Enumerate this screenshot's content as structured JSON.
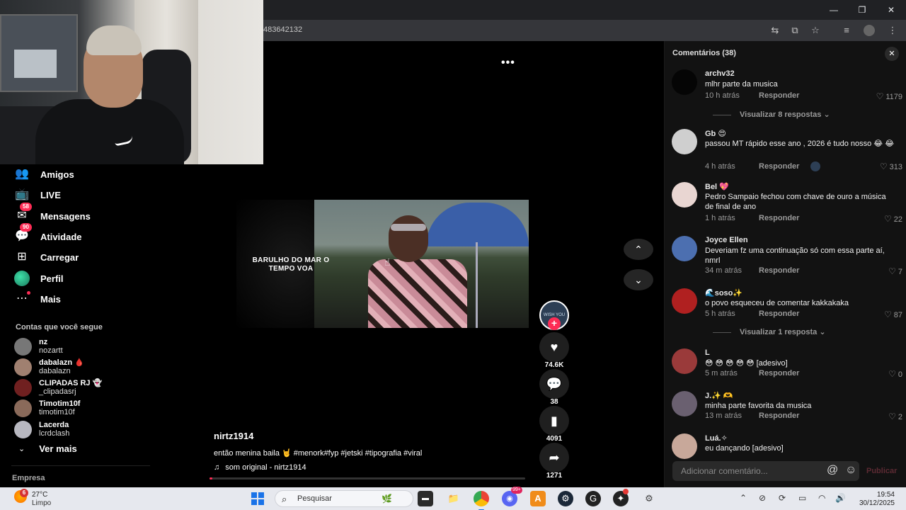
{
  "browser": {
    "url_fragment": "483642132",
    "window_controls": {
      "minimize": "—",
      "maximize": "❐",
      "close": "✕"
    },
    "toolbar_icons": [
      "translate-icon",
      "cast-icon",
      "bookmark-star-icon",
      "media-controls-icon",
      "profile-icon",
      "menu-icon"
    ]
  },
  "sidebar": {
    "nav": [
      {
        "label": "Amigos",
        "icon": "friends-icon",
        "badge": ""
      },
      {
        "label": "LIVE",
        "icon": "live-icon",
        "badge": ""
      },
      {
        "label": "Mensagens",
        "icon": "messages-icon",
        "badge": "58"
      },
      {
        "label": "Atividade",
        "icon": "activity-icon",
        "badge": "90"
      },
      {
        "label": "Carregar",
        "icon": "upload-icon",
        "badge": ""
      },
      {
        "label": "Perfil",
        "icon": "profile-avatar",
        "badge": ""
      },
      {
        "label": "Mais",
        "icon": "more-icon",
        "badge": ""
      }
    ],
    "following_title": "Contas que você segue",
    "following": [
      {
        "name": "nz",
        "user": "nozartt"
      },
      {
        "name": "dabalazn 🩸",
        "user": "dabalazn"
      },
      {
        "name": "CLIPADAS RJ 👻",
        "user": "_clipadasrj"
      },
      {
        "name": "Timotim10f",
        "user": "timotim10f"
      },
      {
        "name": "Lacerda",
        "user": "lcrdclash"
      }
    ],
    "see_more": "Ver mais",
    "footer": "Empresa"
  },
  "video": {
    "caption_overlay": "BARULHO DO MAR O TEMPO VOA",
    "more_button": "•••",
    "author": "nirtz1914",
    "description": "então menina baila 🤘 #menork#fyp #jetski #tipografia #viral",
    "music": "som original - nirtz1914",
    "progress": 0.01,
    "creator_avatar_text": "WISH YOU",
    "counts": {
      "likes": "74.6K",
      "comments": "38",
      "saves": "4091",
      "shares": "1271"
    }
  },
  "comments": {
    "title": "Comentários (38)",
    "reply_label": "Responder",
    "items": [
      {
        "user": "archv32",
        "text": "mlhr parte da musica",
        "time": "10 h atrás",
        "likes": "1179",
        "replies": "Visualizar 8 respostas",
        "avatar_color": "#050505"
      },
      {
        "user": "Gb 😍",
        "text": "passou MT rápido esse ano , 2026 é tudo nosso 😂 😂",
        "time": "4 h atrás",
        "likes": "313",
        "replies": "",
        "avatar_color": "#cfcfcf",
        "creator_liked": true
      },
      {
        "user": "Bel 💖",
        "text": "Pedro Sampaio fechou com chave de ouro a música de final de ano",
        "time": "1 h atrás",
        "likes": "22",
        "replies": "",
        "avatar_color": "#e9d6d2"
      },
      {
        "user": "Joyce Ellen",
        "text": "Deveriam fz uma continuação só com essa parte aí, nmrl",
        "time": "34 m atrás",
        "likes": "7",
        "replies": "",
        "avatar_color": "#4c6fb0"
      },
      {
        "user": "🌊soso✨",
        "text": "o povo esqueceu de comentar kakkakaka",
        "time": "5 h atrás",
        "likes": "87",
        "replies": "Visualizar 1 resposta",
        "avatar_color": "#b02020"
      },
      {
        "user": "L",
        "text": "😳 😳 😳 😳 😳 [adesivo]",
        "time": "5 m atrás",
        "likes": "0",
        "replies": "",
        "avatar_color": "#9a3a3a"
      },
      {
        "user": "J.✨ 🫶",
        "text": "minha parte favorita da musica",
        "time": "13 m atrás",
        "likes": "2",
        "replies": "",
        "avatar_color": "#6a6070"
      },
      {
        "user": "Luá.✧",
        "text": "eu dançando [adesivo]",
        "time": "",
        "likes": "",
        "replies": "",
        "avatar_color": "#c8a89a"
      }
    ],
    "input_placeholder": "Adicionar comentário...",
    "post_label": "Publicar"
  },
  "taskbar": {
    "weather_badge": "6",
    "temperature": "27°C",
    "condition": "Limpo",
    "search_placeholder": "Pesquisar",
    "apps": [
      "start-icon",
      "file-manager-icon",
      "folder-icon",
      "chrome-icon",
      "discord-icon",
      "app-icon",
      "steam-icon",
      "game-icon",
      "game-bar-icon",
      "settings-icon"
    ],
    "discord_badge": "99+",
    "time": "19:54",
    "date": "30/12/2025"
  }
}
